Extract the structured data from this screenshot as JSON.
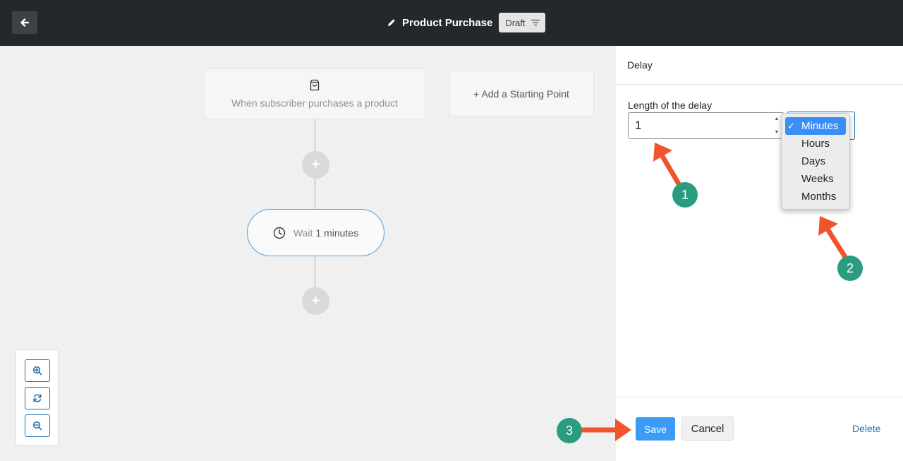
{
  "header": {
    "title": "Product Purchase",
    "status_chip": "Draft",
    "icons": {
      "back": "arrow-left-icon",
      "edit": "pencil-icon",
      "filter": "filter-lines-icon"
    }
  },
  "canvas": {
    "trigger_text": "When subscriber purchases a product",
    "add_starting_point": "+ Add a Starting Point",
    "plus_symbol": "+",
    "wait_label": "Wait",
    "wait_value": "1 minutes"
  },
  "panel": {
    "title": "Delay",
    "field_label": "Length of the delay",
    "delay_value": "1",
    "unit_options": [
      "Minutes",
      "Hours",
      "Days",
      "Weeks",
      "Months"
    ],
    "selected_check": "✓",
    "save_label": "Save",
    "cancel_label": "Cancel",
    "delete_label": "Delete"
  },
  "annotations": {
    "badge_1": "1",
    "badge_2": "2",
    "badge_3": "3",
    "arrow_color": "#f0542c",
    "badge_color": "#2a9d80"
  },
  "colors": {
    "topbar": "#23282d",
    "accent": "#3a9cf5",
    "link": "#2271b1"
  }
}
